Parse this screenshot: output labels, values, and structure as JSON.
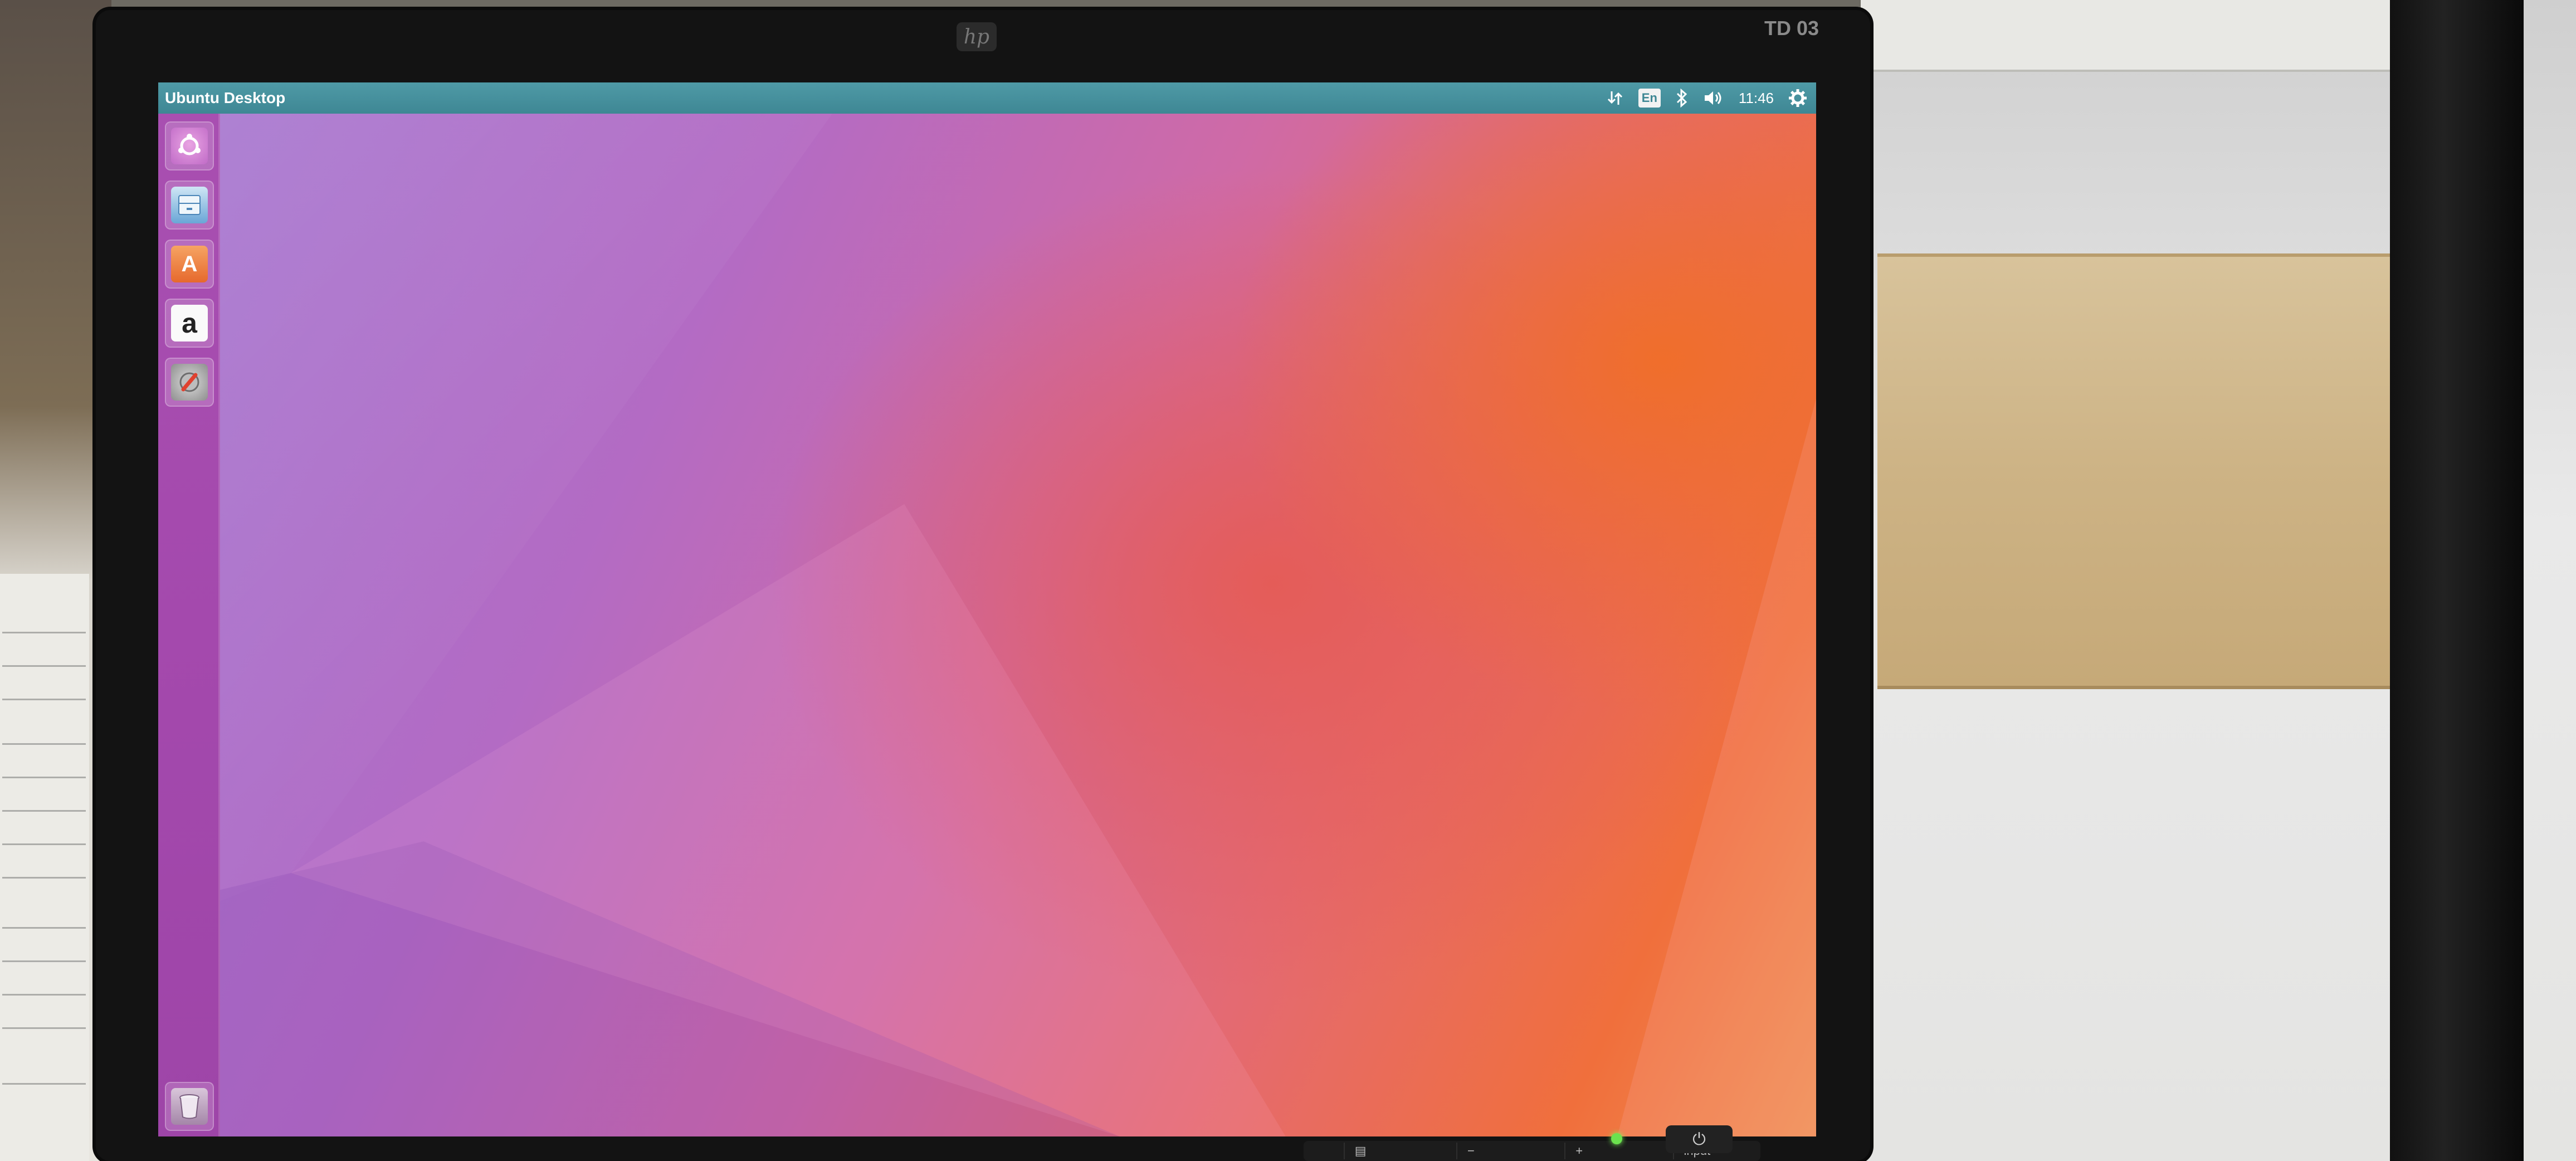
{
  "panel": {
    "title": "Ubuntu Desktop",
    "indicators": {
      "network_icon": "network-arrows-icon",
      "keyboard_layout": "En",
      "bluetooth_icon": "bluetooth-icon",
      "volume_icon": "volume-icon",
      "clock": "11:46",
      "system_icon": "gear-icon"
    }
  },
  "launcher": {
    "items": [
      {
        "name": "ubuntu-home",
        "icon": "ubuntu-logo-icon"
      },
      {
        "name": "files",
        "icon": "file-cabinet-icon"
      },
      {
        "name": "software-center",
        "icon": "shopping-bag-icon",
        "glyph": "A"
      },
      {
        "name": "amazon",
        "icon": "amazon-icon",
        "glyph": "a"
      },
      {
        "name": "system-settings",
        "icon": "settings-wrench-icon"
      }
    ],
    "trash": {
      "icon": "trash-icon"
    }
  },
  "monitor": {
    "brand_logo": "hp",
    "asset_tag": "TD 03",
    "buttons": {
      "input_label": "input",
      "minus_label": "−",
      "plus_label": "+",
      "menu_label": "▤"
    },
    "power_glyph": "⏻",
    "power_led_color": "#6be24e"
  },
  "colors": {
    "panel_bg": "#3e8794",
    "launcher_bg": "#a449ad",
    "wallpaper_orange": "#f06f3c",
    "wallpaper_purple": "#a476d0"
  }
}
